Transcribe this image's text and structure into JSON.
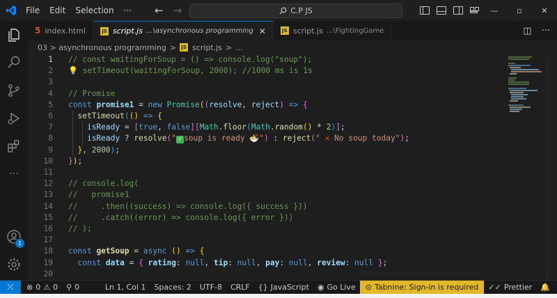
{
  "menu": {
    "file": "File",
    "edit": "Edit",
    "selection": "Selection",
    "more": "···"
  },
  "search": {
    "label": "C.P JS"
  },
  "tabs": [
    {
      "name": "index.html",
      "desc": "",
      "active": false
    },
    {
      "name": "script.js",
      "desc": "...\\asynchronous programming",
      "active": true
    },
    {
      "name": "script.js",
      "desc": "...\\FightingGame",
      "active": false
    }
  ],
  "breadcrumb": {
    "folder": "03 > asynchronous programming",
    "file": "script.js",
    "trail": "..."
  },
  "gutter": [
    "1",
    "2",
    "3",
    "4",
    "5",
    "6",
    "7",
    "8",
    "9",
    "10",
    "11",
    "12",
    "13",
    "14",
    "15",
    "16",
    "17",
    "18",
    "19",
    "20"
  ],
  "code": {
    "l1": "// const waitingForSoup = () => console.log(\"soup\");",
    "l2": " setTimeout(waitingForSoup, 2000); //1000 ms is 1s",
    "l4": "// Promise",
    "l12": "// console.log(",
    "l13": "//   promise1",
    "l14": "//     .then((success) => console.log({ success }))",
    "l15": "//     .catch((error) => console.log({ error }))",
    "l16": "// );"
  },
  "activity": {
    "account_badge": "1"
  },
  "status": {
    "problems_errors": "0",
    "problems_warnings": "0",
    "ports": "0",
    "cursor": "Ln 1, Col 1",
    "spaces": "Spaces: 2",
    "encoding": "UTF-8",
    "eol": "CRLF",
    "language": "JavaScript",
    "golive": "Go Live",
    "tabnine": "Tabnine: Sign-in is required",
    "prettier": "Prettier"
  },
  "colors": {
    "accent": "#0078d4",
    "tabnine": "#e2b82a",
    "comment": "#6a9955",
    "keyword": "#569cd6",
    "string": "#ce9178"
  }
}
